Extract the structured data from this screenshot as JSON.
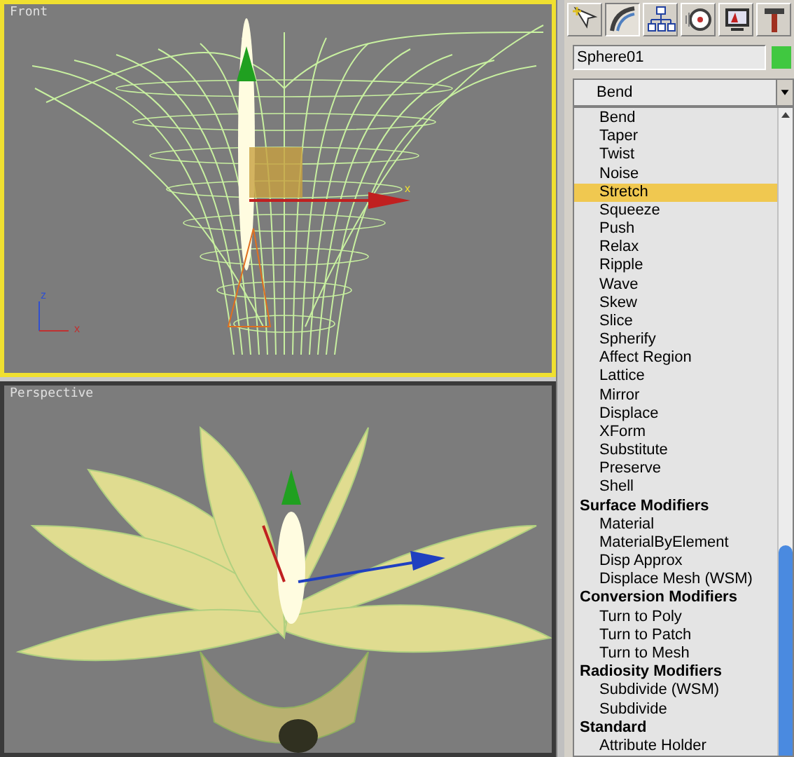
{
  "viewports": [
    {
      "label": "Front",
      "active": true,
      "axis_labels": [
        "z",
        "x"
      ],
      "gizmo_label": "x"
    },
    {
      "label": "Perspective",
      "active": false
    }
  ],
  "command_panel": {
    "tabs": [
      {
        "kind": "create",
        "selected": false
      },
      {
        "kind": "modify",
        "selected": true
      },
      {
        "kind": "hierarchy",
        "selected": false
      },
      {
        "kind": "motion",
        "selected": false
      },
      {
        "kind": "display",
        "selected": false
      },
      {
        "kind": "utilities",
        "selected": false
      }
    ],
    "object": {
      "name": "Sphere01",
      "color": "#40c840"
    },
    "modifier_dropdown": "Bend",
    "modifier_list": [
      {
        "label": "Bend",
        "kind": "item",
        "selected": false
      },
      {
        "label": "Taper",
        "kind": "item",
        "selected": false
      },
      {
        "label": "Twist",
        "kind": "item",
        "selected": false
      },
      {
        "label": "Noise",
        "kind": "item",
        "selected": false
      },
      {
        "label": "Stretch",
        "kind": "item",
        "selected": true
      },
      {
        "label": "Squeeze",
        "kind": "item",
        "selected": false
      },
      {
        "label": "Push",
        "kind": "item",
        "selected": false
      },
      {
        "label": "Relax",
        "kind": "item",
        "selected": false
      },
      {
        "label": "Ripple",
        "kind": "item",
        "selected": false
      },
      {
        "label": "Wave",
        "kind": "item",
        "selected": false
      },
      {
        "label": "Skew",
        "kind": "item",
        "selected": false
      },
      {
        "label": "Slice",
        "kind": "item",
        "selected": false
      },
      {
        "label": "Spherify",
        "kind": "item",
        "selected": false
      },
      {
        "label": "Affect Region",
        "kind": "item",
        "selected": false
      },
      {
        "label": "Lattice",
        "kind": "item",
        "selected": false
      },
      {
        "label": "Mirror",
        "kind": "item",
        "selected": false
      },
      {
        "label": "Displace",
        "kind": "item",
        "selected": false
      },
      {
        "label": "XForm",
        "kind": "item",
        "selected": false
      },
      {
        "label": "Substitute",
        "kind": "item",
        "selected": false
      },
      {
        "label": "Preserve",
        "kind": "item",
        "selected": false
      },
      {
        "label": "Shell",
        "kind": "item",
        "selected": false
      },
      {
        "label": "Surface Modifiers",
        "kind": "header",
        "selected": false
      },
      {
        "label": "Material",
        "kind": "item",
        "selected": false
      },
      {
        "label": "MaterialByElement",
        "kind": "item",
        "selected": false
      },
      {
        "label": "Disp Approx",
        "kind": "item",
        "selected": false
      },
      {
        "label": "Displace Mesh (WSM)",
        "kind": "item",
        "selected": false
      },
      {
        "label": "Conversion Modifiers",
        "kind": "header",
        "selected": false
      },
      {
        "label": "Turn to Poly",
        "kind": "item",
        "selected": false
      },
      {
        "label": "Turn to Patch",
        "kind": "item",
        "selected": false
      },
      {
        "label": "Turn to Mesh",
        "kind": "item",
        "selected": false
      },
      {
        "label": "Radiosity Modifiers",
        "kind": "header",
        "selected": false
      },
      {
        "label": "Subdivide (WSM)",
        "kind": "item",
        "selected": false
      },
      {
        "label": "Subdivide",
        "kind": "item",
        "selected": false
      },
      {
        "label": "Standard",
        "kind": "header",
        "selected": false
      },
      {
        "label": "Attribute Holder",
        "kind": "item",
        "selected": false
      }
    ]
  }
}
